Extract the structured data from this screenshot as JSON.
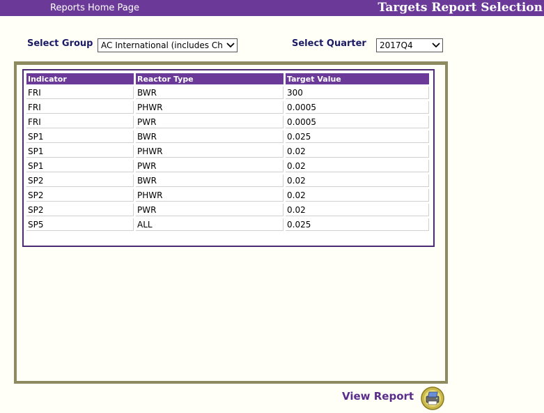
{
  "header": {
    "home_link": "Reports Home Page",
    "title": "Targets Report Selection"
  },
  "filters": {
    "group_label": "Select Group",
    "group_value": "AC International (includes ChP",
    "quarter_label": "Select Quarter",
    "quarter_value": "2017Q4"
  },
  "table": {
    "columns": [
      "Indicator",
      "Reactor Type",
      "Target Value"
    ],
    "rows": [
      [
        "FRI",
        "BWR",
        "300"
      ],
      [
        "FRI",
        "PHWR",
        "0.0005"
      ],
      [
        "FRI",
        "PWR",
        "0.0005"
      ],
      [
        "SP1",
        "BWR",
        "0.025"
      ],
      [
        "SP1",
        "PHWR",
        "0.02"
      ],
      [
        "SP1",
        "PWR",
        "0.02"
      ],
      [
        "SP2",
        "BWR",
        "0.02"
      ],
      [
        "SP2",
        "PHWR",
        "0.02"
      ],
      [
        "SP2",
        "PWR",
        "0.02"
      ],
      [
        "SP5",
        "ALL",
        "0.025"
      ]
    ]
  },
  "actions": {
    "view_report": "View Report",
    "view_report_icon": "printer-icon"
  },
  "colors": {
    "header_bg": "#6b3a99",
    "frame_border": "#8c8a5e",
    "table_border": "#4a2a73",
    "label_color": "#1a1a66"
  }
}
